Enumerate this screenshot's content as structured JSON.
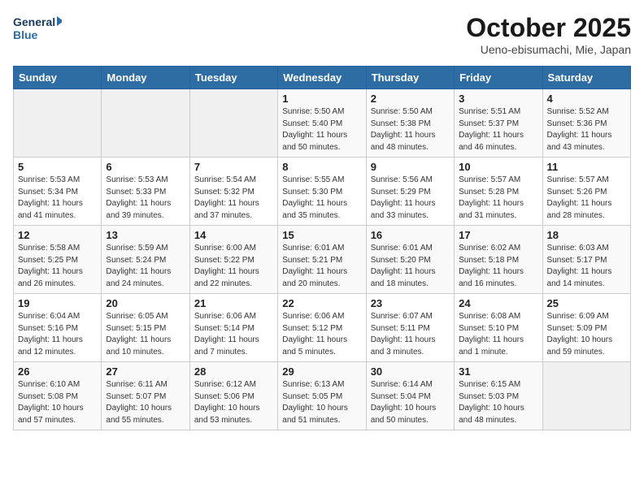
{
  "header": {
    "logo_general": "General",
    "logo_blue": "Blue",
    "month": "October 2025",
    "location": "Ueno-ebisumachi, Mie, Japan"
  },
  "weekdays": [
    "Sunday",
    "Monday",
    "Tuesday",
    "Wednesday",
    "Thursday",
    "Friday",
    "Saturday"
  ],
  "weeks": [
    [
      {
        "day": "",
        "info": ""
      },
      {
        "day": "",
        "info": ""
      },
      {
        "day": "",
        "info": ""
      },
      {
        "day": "1",
        "info": "Sunrise: 5:50 AM\nSunset: 5:40 PM\nDaylight: 11 hours\nand 50 minutes."
      },
      {
        "day": "2",
        "info": "Sunrise: 5:50 AM\nSunset: 5:38 PM\nDaylight: 11 hours\nand 48 minutes."
      },
      {
        "day": "3",
        "info": "Sunrise: 5:51 AM\nSunset: 5:37 PM\nDaylight: 11 hours\nand 46 minutes."
      },
      {
        "day": "4",
        "info": "Sunrise: 5:52 AM\nSunset: 5:36 PM\nDaylight: 11 hours\nand 43 minutes."
      }
    ],
    [
      {
        "day": "5",
        "info": "Sunrise: 5:53 AM\nSunset: 5:34 PM\nDaylight: 11 hours\nand 41 minutes."
      },
      {
        "day": "6",
        "info": "Sunrise: 5:53 AM\nSunset: 5:33 PM\nDaylight: 11 hours\nand 39 minutes."
      },
      {
        "day": "7",
        "info": "Sunrise: 5:54 AM\nSunset: 5:32 PM\nDaylight: 11 hours\nand 37 minutes."
      },
      {
        "day": "8",
        "info": "Sunrise: 5:55 AM\nSunset: 5:30 PM\nDaylight: 11 hours\nand 35 minutes."
      },
      {
        "day": "9",
        "info": "Sunrise: 5:56 AM\nSunset: 5:29 PM\nDaylight: 11 hours\nand 33 minutes."
      },
      {
        "day": "10",
        "info": "Sunrise: 5:57 AM\nSunset: 5:28 PM\nDaylight: 11 hours\nand 31 minutes."
      },
      {
        "day": "11",
        "info": "Sunrise: 5:57 AM\nSunset: 5:26 PM\nDaylight: 11 hours\nand 28 minutes."
      }
    ],
    [
      {
        "day": "12",
        "info": "Sunrise: 5:58 AM\nSunset: 5:25 PM\nDaylight: 11 hours\nand 26 minutes."
      },
      {
        "day": "13",
        "info": "Sunrise: 5:59 AM\nSunset: 5:24 PM\nDaylight: 11 hours\nand 24 minutes."
      },
      {
        "day": "14",
        "info": "Sunrise: 6:00 AM\nSunset: 5:22 PM\nDaylight: 11 hours\nand 22 minutes."
      },
      {
        "day": "15",
        "info": "Sunrise: 6:01 AM\nSunset: 5:21 PM\nDaylight: 11 hours\nand 20 minutes."
      },
      {
        "day": "16",
        "info": "Sunrise: 6:01 AM\nSunset: 5:20 PM\nDaylight: 11 hours\nand 18 minutes."
      },
      {
        "day": "17",
        "info": "Sunrise: 6:02 AM\nSunset: 5:18 PM\nDaylight: 11 hours\nand 16 minutes."
      },
      {
        "day": "18",
        "info": "Sunrise: 6:03 AM\nSunset: 5:17 PM\nDaylight: 11 hours\nand 14 minutes."
      }
    ],
    [
      {
        "day": "19",
        "info": "Sunrise: 6:04 AM\nSunset: 5:16 PM\nDaylight: 11 hours\nand 12 minutes."
      },
      {
        "day": "20",
        "info": "Sunrise: 6:05 AM\nSunset: 5:15 PM\nDaylight: 11 hours\nand 10 minutes."
      },
      {
        "day": "21",
        "info": "Sunrise: 6:06 AM\nSunset: 5:14 PM\nDaylight: 11 hours\nand 7 minutes."
      },
      {
        "day": "22",
        "info": "Sunrise: 6:06 AM\nSunset: 5:12 PM\nDaylight: 11 hours\nand 5 minutes."
      },
      {
        "day": "23",
        "info": "Sunrise: 6:07 AM\nSunset: 5:11 PM\nDaylight: 11 hours\nand 3 minutes."
      },
      {
        "day": "24",
        "info": "Sunrise: 6:08 AM\nSunset: 5:10 PM\nDaylight: 11 hours\nand 1 minute."
      },
      {
        "day": "25",
        "info": "Sunrise: 6:09 AM\nSunset: 5:09 PM\nDaylight: 10 hours\nand 59 minutes."
      }
    ],
    [
      {
        "day": "26",
        "info": "Sunrise: 6:10 AM\nSunset: 5:08 PM\nDaylight: 10 hours\nand 57 minutes."
      },
      {
        "day": "27",
        "info": "Sunrise: 6:11 AM\nSunset: 5:07 PM\nDaylight: 10 hours\nand 55 minutes."
      },
      {
        "day": "28",
        "info": "Sunrise: 6:12 AM\nSunset: 5:06 PM\nDaylight: 10 hours\nand 53 minutes."
      },
      {
        "day": "29",
        "info": "Sunrise: 6:13 AM\nSunset: 5:05 PM\nDaylight: 10 hours\nand 51 minutes."
      },
      {
        "day": "30",
        "info": "Sunrise: 6:14 AM\nSunset: 5:04 PM\nDaylight: 10 hours\nand 50 minutes."
      },
      {
        "day": "31",
        "info": "Sunrise: 6:15 AM\nSunset: 5:03 PM\nDaylight: 10 hours\nand 48 minutes."
      },
      {
        "day": "",
        "info": ""
      }
    ]
  ]
}
